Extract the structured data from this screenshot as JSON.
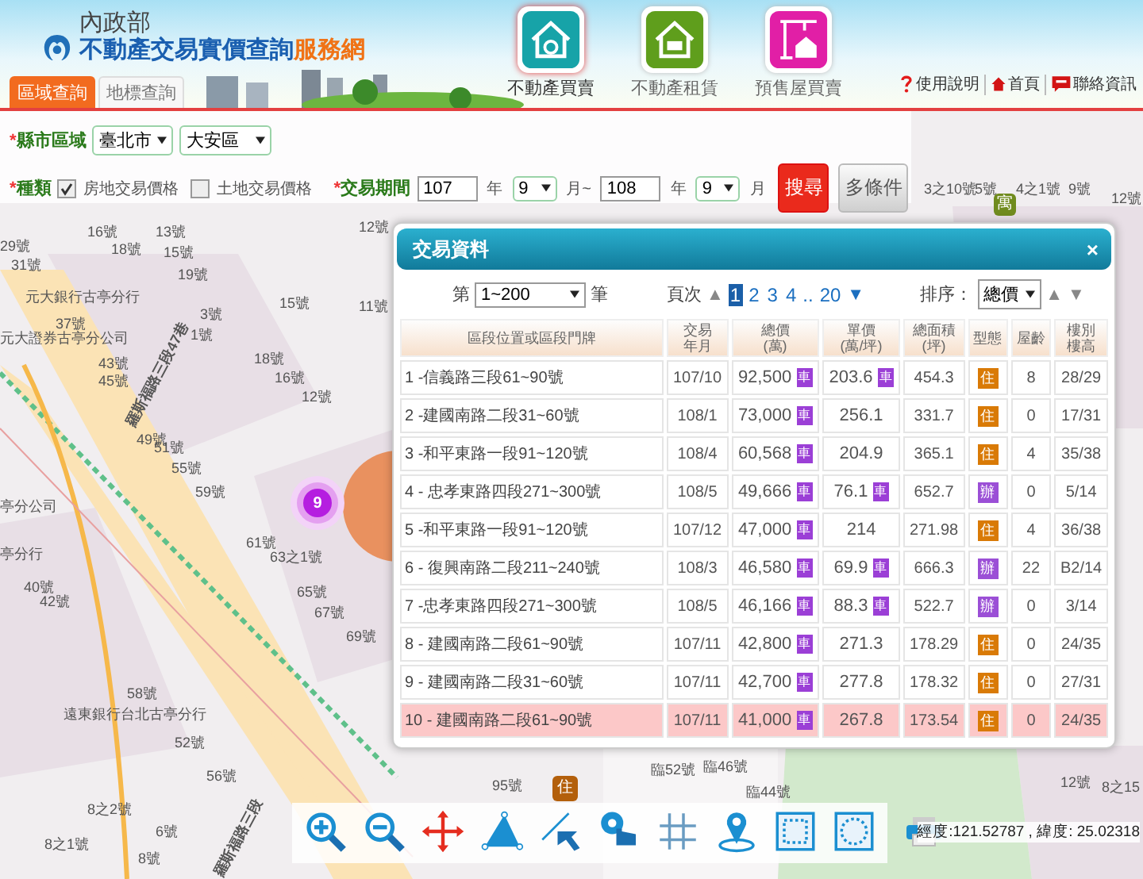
{
  "header": {
    "ministry": "內政部",
    "title_main": "不動產交易實價查詢",
    "title_accent": "服務網",
    "nav": [
      {
        "label": "不動產買賣",
        "kind": "sale",
        "selected": true
      },
      {
        "label": "不動產租賃",
        "kind": "rent",
        "selected": false
      },
      {
        "label": "預售屋買賣",
        "kind": "presale",
        "selected": false
      }
    ],
    "links": [
      {
        "label": "使用說明",
        "kind": "help"
      },
      {
        "label": "首頁",
        "kind": "home"
      },
      {
        "label": "聯絡資訊",
        "kind": "contact"
      }
    ],
    "tabs": [
      {
        "label": "區域查詢",
        "selected": true
      },
      {
        "label": "地標查詢",
        "selected": false
      }
    ]
  },
  "filters": {
    "region": {
      "mark": "*",
      "label": "縣市區域",
      "city": "臺北市",
      "district": "大安區"
    },
    "type": {
      "mark": "*",
      "label": "種類",
      "options": [
        {
          "label": "房地交易價格",
          "checked": true
        },
        {
          "label": "土地交易價格",
          "checked": false
        }
      ]
    },
    "period": {
      "mark": "*",
      "label": "交易期間",
      "from_year": "107",
      "year_unit_1": "年",
      "from_month": "9",
      "month_unit_1": "月~",
      "to_year": "108",
      "year_unit_2": "年",
      "to_month": "9",
      "month_unit_2": "月"
    },
    "buttons": [
      {
        "label": "搜尋",
        "kind": "primary"
      },
      {
        "label": "多條件",
        "kind": "secondary"
      }
    ]
  },
  "map": {
    "labels": [
      "3之10號",
      "5號",
      "4之1號",
      "9號",
      "12號",
      "29號",
      "16號",
      "13號",
      "18號",
      "15號",
      "31號",
      "19號",
      "12號",
      "15號",
      "11號",
      "元大銀行古亭分行",
      "37號",
      "元大證券古亭分公司",
      "3號",
      "1號",
      "43號",
      "45號",
      "18號",
      "16號",
      "12號",
      "49號",
      "51號",
      "55號",
      "59號",
      "亭分公司",
      "61號",
      "63之1號",
      "亭分行",
      "65號",
      "67號",
      "69號",
      "40號",
      "42號",
      "58號",
      "遠東銀行台北古亭分行",
      "52號",
      "56號",
      "8之2號",
      "6號",
      "8之1號",
      "8號",
      "95號",
      "臨52號",
      "臨46號",
      "臨44號",
      "12號",
      "8之15"
    ],
    "roads": [
      "羅斯福路三段47巷",
      "羅斯福路三段"
    ],
    "markers": [
      {
        "text": "寓",
        "kind": "apartment"
      },
      {
        "text": "9",
        "kind": "cluster"
      },
      {
        "text": "住",
        "kind": "residential"
      }
    ],
    "coordinates": "經度:121.52787 , 緯度: 25.02318"
  },
  "dialog": {
    "title": "交易資料",
    "close": "×",
    "range_prefix": "第",
    "range": "1~200",
    "range_suffix": "筆",
    "page_label": "頁次",
    "up": "▲",
    "pages": [
      {
        "label": "1",
        "selected": true
      },
      {
        "label": "2",
        "selected": false
      },
      {
        "label": "3",
        "selected": false
      },
      {
        "label": "4",
        "selected": false
      }
    ],
    "ellipsis": "..",
    "last_page": "20",
    "down": "▼",
    "sort_label": "排序：",
    "sort": "總價",
    "sort_up": "▲",
    "sort_down": "▼",
    "columns": [
      [
        "區段位置或區段門牌"
      ],
      [
        "交易",
        "年月"
      ],
      [
        "總價",
        "(萬)"
      ],
      [
        "單價",
        "(萬/坪)"
      ],
      [
        "總面積",
        "(坪)"
      ],
      [
        "型態"
      ],
      [
        "屋齡"
      ],
      [
        "樓別",
        "樓高"
      ]
    ],
    "rows": [
      {
        "location": "1 -信義路三段61~90號",
        "date": "107/10",
        "total": "92,500",
        "total_badge": "車",
        "unit": "203.6",
        "unit_badge": "車",
        "area": "454.3",
        "type": {
          "text": "住",
          "kind": "residential"
        },
        "age": "8",
        "floor": "28/29",
        "selected": false
      },
      {
        "location": "2 -建國南路二段31~60號",
        "date": "108/1",
        "total": "73,000",
        "total_badge": "車",
        "unit": "256.1",
        "area": "331.7",
        "type": {
          "text": "住",
          "kind": "residential"
        },
        "age": "0",
        "floor": "17/31",
        "selected": false
      },
      {
        "location": "3 -和平東路一段91~120號",
        "date": "108/4",
        "total": "60,568",
        "total_badge": "車",
        "unit": "204.9",
        "area": "365.1",
        "type": {
          "text": "住",
          "kind": "residential"
        },
        "age": "4",
        "floor": "35/38",
        "selected": false
      },
      {
        "location": "4 - 忠孝東路四段271~300號",
        "date": "108/5",
        "total": "49,666",
        "total_badge": "車",
        "unit": "76.1",
        "unit_badge": "車",
        "area": "652.7",
        "type": {
          "text": "辦",
          "kind": "office"
        },
        "age": "0",
        "floor": "5/14",
        "selected": false
      },
      {
        "location": "5 -和平東路一段91~120號",
        "date": "107/12",
        "total": "47,000",
        "total_badge": "車",
        "unit": "214",
        "area": "271.98",
        "type": {
          "text": "住",
          "kind": "residential"
        },
        "age": "4",
        "floor": "36/38",
        "selected": false
      },
      {
        "location": "6 - 復興南路二段211~240號",
        "date": "108/3",
        "total": "46,580",
        "total_badge": "車",
        "unit": "69.9",
        "unit_badge": "車",
        "area": "666.3",
        "type": {
          "text": "辦",
          "kind": "office"
        },
        "age": "22",
        "floor": "B2/14",
        "selected": false
      },
      {
        "location": "7 -忠孝東路四段271~300號",
        "date": "108/5",
        "total": "46,166",
        "total_badge": "車",
        "unit": "88.3",
        "unit_badge": "車",
        "area": "522.7",
        "type": {
          "text": "辦",
          "kind": "office"
        },
        "age": "0",
        "floor": "3/14",
        "selected": false
      },
      {
        "location": "8 - 建國南路二段61~90號",
        "date": "107/11",
        "total": "42,800",
        "total_badge": "車",
        "unit": "271.3",
        "area": "178.29",
        "type": {
          "text": "住",
          "kind": "residential"
        },
        "age": "0",
        "floor": "24/35",
        "selected": false
      },
      {
        "location": "9 - 建國南路二段31~60號",
        "date": "107/11",
        "total": "42,700",
        "total_badge": "車",
        "unit": "277.8",
        "area": "178.32",
        "type": {
          "text": "住",
          "kind": "residential"
        },
        "age": "0",
        "floor": "27/31",
        "selected": false
      },
      {
        "location": "10 - 建國南路二段61~90號",
        "date": "107/11",
        "total": "41,000",
        "total_badge": "車",
        "unit": "267.8",
        "area": "173.54",
        "type": {
          "text": "住",
          "kind": "residential"
        },
        "age": "0",
        "floor": "24/35",
        "selected": true
      }
    ]
  },
  "toolbar": [
    {
      "kind": "zoom-in"
    },
    {
      "kind": "zoom-out"
    },
    {
      "kind": "pan"
    },
    {
      "kind": "area"
    },
    {
      "kind": "select"
    },
    {
      "kind": "touch"
    },
    {
      "kind": "grid"
    },
    {
      "kind": "pin"
    },
    {
      "kind": "frame-square"
    },
    {
      "kind": "frame-circle"
    }
  ]
}
